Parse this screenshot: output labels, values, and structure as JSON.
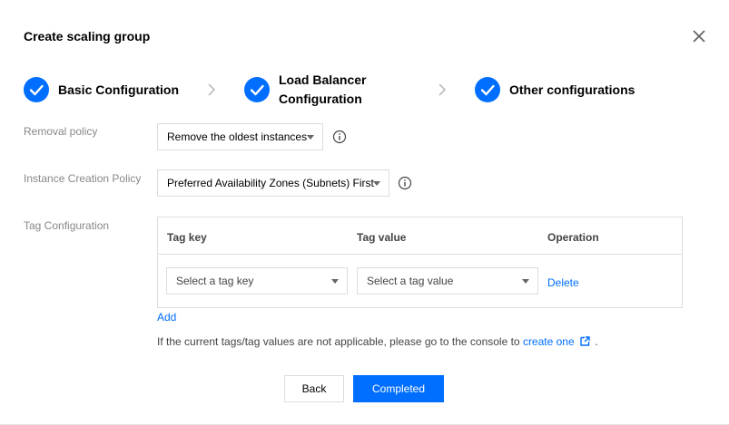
{
  "dialog": {
    "title": "Create scaling group"
  },
  "steps": [
    {
      "label": "Basic Configuration",
      "status": "completed"
    },
    {
      "label_line1": "Load Balancer",
      "label_line2": "Configuration",
      "status": "completed"
    },
    {
      "label": "Other configurations",
      "status": "current"
    }
  ],
  "form": {
    "removal_policy": {
      "label": "Removal policy",
      "value": "Remove the oldest instances"
    },
    "instance_creation_policy": {
      "label": "Instance Creation Policy",
      "value": "Preferred Availability Zones (Subnets) First"
    },
    "tag_configuration": {
      "label": "Tag Configuration",
      "columns": [
        "Tag key",
        "Tag value",
        "Operation"
      ],
      "rows": [
        {
          "tag_key_placeholder": "Select a tag key",
          "tag_value_placeholder": "Select a tag value",
          "operation": "Delete"
        }
      ],
      "add_label": "Add",
      "hint_text": "If the current tags/tag values are not applicable, please go to the console to ",
      "hint_link": "create one",
      "hint_end": "."
    }
  },
  "footer": {
    "back_label": "Back",
    "completed_label": "Completed"
  },
  "colors": {
    "accent": "#006eff",
    "label_gray": "#888888",
    "border": "#dddddd"
  },
  "icons": [
    "close-icon",
    "check-icon",
    "chevron-right-icon",
    "info-icon",
    "caret-down-icon",
    "external-link-icon"
  ]
}
